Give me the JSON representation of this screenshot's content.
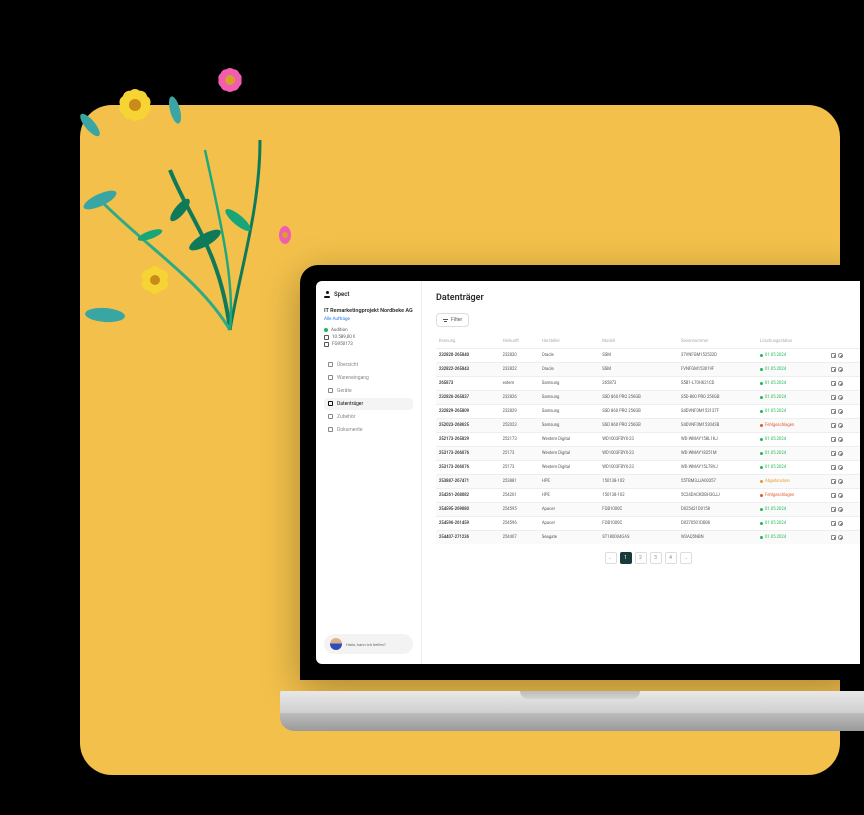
{
  "brand": {
    "name": "Spect"
  },
  "project": {
    "title": "IT Remarketingprojekt Nordbeke AG",
    "all_projects": "Alle Aufträge",
    "status": "Audition",
    "amount": "10.589,00 €",
    "ref": "FG950173"
  },
  "nav": {
    "overview": "Übersicht",
    "incoming": "Wareneingang",
    "devices": "Geräte",
    "drives": "Datenträger",
    "accessories": "Zubehör",
    "documents": "Dokumente"
  },
  "help": {
    "text": "Hallo, kann ich helfen?"
  },
  "main": {
    "title": "Datenträger",
    "filter_label": "Filter"
  },
  "table": {
    "columns": [
      "Kennung",
      "Herkunft",
      "Hersteller",
      "Modell",
      "Seriennummer",
      "Löschungsstatus",
      ""
    ],
    "rows": [
      {
        "id": "232820-265840",
        "origin": "232820",
        "vendor": "Oracle",
        "model": "SSM",
        "serial": "37VNFGM152522D",
        "status_type": "ok",
        "status": "01.05.2024"
      },
      {
        "id": "232822-265843",
        "origin": "232822",
        "vendor": "Oracle",
        "model": "SSM",
        "serial": "FVNFGM153019F",
        "status_type": "ok",
        "status": "01.05.2024"
      },
      {
        "id": "265873",
        "origin": "extern",
        "vendor": "Samsung",
        "model": "265873",
        "serial": "S5B1-L70H621CD",
        "status_type": "ok",
        "status": "01.05.2024"
      },
      {
        "id": "232826-265837",
        "origin": "232826",
        "vendor": "Samsung",
        "model": "SSD 860 PRO 256GB",
        "serial": "S5D-860 PRO 256GB",
        "status_type": "ok",
        "status": "01.05.2024"
      },
      {
        "id": "232829-265809",
        "origin": "232829",
        "vendor": "Samsung",
        "model": "SSD 860 PRO 256GB",
        "serial": "S4DVNF0M153137F",
        "status_type": "ok",
        "status": "01.05.2024"
      },
      {
        "id": "252023-268625",
        "origin": "252023",
        "vendor": "Samsung",
        "model": "SSD 860 PRO 256GB",
        "serial": "S4DVNF0M153043B",
        "status_type": "fail",
        "status": "Fehlgeschlagen"
      },
      {
        "id": "252173-265829",
        "origin": "252173",
        "vendor": "Western Digital",
        "model": "WD1003FBYX-23",
        "serial": "WD-WMAY158L1KJ",
        "status_type": "ok",
        "status": "01.05.2024"
      },
      {
        "id": "253173-266076",
        "origin": "25173",
        "vendor": "Western Digital",
        "model": "WD1003FBYX-23",
        "serial": "WD-WMAY18251M",
        "status_type": "ok",
        "status": "01.05.2024"
      },
      {
        "id": "253173-266076",
        "origin": "25173",
        "vendor": "Western Digital",
        "model": "WD1003FBYX-23",
        "serial": "WD-WMAY15L78VJ",
        "status_type": "ok",
        "status": "01.05.2024"
      },
      {
        "id": "253887-267471",
        "origin": "253881",
        "vendor": "HPE",
        "model": "150138-102",
        "serial": "55TBM3JJA00357",
        "status_type": "warn",
        "status": "Abgebrochen"
      },
      {
        "id": "254261-268082",
        "origin": "254261",
        "vendor": "HPE",
        "model": "150138-102",
        "serial": "5C24DACKDBH3GJJ",
        "status_type": "fail",
        "status": "Fehlgeschlagen"
      },
      {
        "id": "254595-269080",
        "origin": "254595",
        "vendor": "Apacer",
        "model": "FOB1000C",
        "serial": "D025421D0158",
        "status_type": "ok",
        "status": "01.05.2024"
      },
      {
        "id": "254596-261459",
        "origin": "254596",
        "vendor": "Apacer",
        "model": "FOB1000C",
        "serial": "D0270501DB06",
        "status_type": "ok",
        "status": "01.05.2024"
      },
      {
        "id": "254407-271236",
        "origin": "254407",
        "vendor": "Seagate",
        "model": "ST180004GAS",
        "serial": "W3AQ5NBN",
        "status_type": "ok",
        "status": "01.05.2024"
      }
    ]
  },
  "pagination": {
    "pages": [
      "1",
      "2",
      "3",
      "4"
    ],
    "active": 1
  }
}
